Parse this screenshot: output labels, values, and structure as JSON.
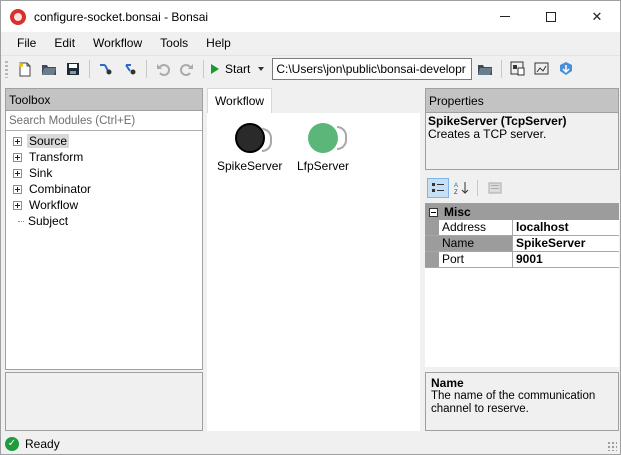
{
  "window": {
    "title": "configure-socket.bonsai - Bonsai"
  },
  "menu": [
    "File",
    "Edit",
    "Workflow",
    "Tools",
    "Help"
  ],
  "toolbar": {
    "start_label": "Start",
    "path_value": "C:\\Users\\jon\\public\\bonsai-developr"
  },
  "toolbox": {
    "header": "Toolbox",
    "search_placeholder": "Search Modules (Ctrl+E)",
    "items": [
      {
        "label": "Source",
        "expandable": true,
        "selected": true
      },
      {
        "label": "Transform",
        "expandable": true
      },
      {
        "label": "Sink",
        "expandable": true
      },
      {
        "label": "Combinator",
        "expandable": true
      },
      {
        "label": "Workflow",
        "expandable": true
      },
      {
        "label": "Subject",
        "expandable": false
      }
    ]
  },
  "workflow": {
    "tab_label": "Workflow",
    "nodes": [
      {
        "label": "SpikeServer",
        "color": "#2a2a2a",
        "selected": true
      },
      {
        "label": "LfpServer",
        "color": "#5bb679",
        "selected": false
      }
    ]
  },
  "properties": {
    "header": "Properties",
    "title": "SpikeServer (TcpServer)",
    "description": "Creates a TCP server.",
    "category": "Misc",
    "rows": [
      {
        "name": "Address",
        "value": "localhost"
      },
      {
        "name": "Name",
        "value": "SpikeServer"
      },
      {
        "name": "Port",
        "value": "9001"
      }
    ],
    "help_title": "Name",
    "help_text": "The name of the communication channel to reserve."
  },
  "status": {
    "text": "Ready"
  },
  "colors": {
    "start_green": "#1a9b2d",
    "panel_header": "#c3c3c3",
    "status_ok": "#1f9b3b"
  }
}
